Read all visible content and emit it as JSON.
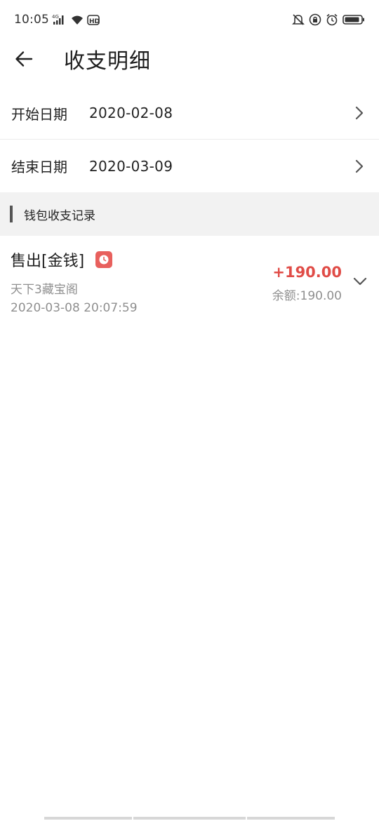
{
  "status_bar": {
    "time": "10:05",
    "network": "4G",
    "hd": "HD",
    "icons": [
      "signal-icon",
      "wifi-icon",
      "hd-icon",
      "mute-icon",
      "lock-rotation-icon",
      "alarm-icon",
      "battery-icon"
    ]
  },
  "header": {
    "title": "收支明细",
    "back_icon": "back-arrow-icon"
  },
  "dates": [
    {
      "label": "开始日期",
      "value": "2020-02-08"
    },
    {
      "label": "结束日期",
      "value": "2020-03-09"
    }
  ],
  "section": {
    "title": "钱包收支记录"
  },
  "records": [
    {
      "title": "售出[金钱]",
      "badge_icon": "clock-icon",
      "source": "天下3藏宝阁",
      "time": "2020-03-08 20:07:59",
      "amount": "+190.00",
      "balance_label": "余额:",
      "balance_value": "190.00"
    }
  ],
  "colors": {
    "amount_positive": "#e04c47",
    "badge": "#e8605d",
    "muted_text": "#8f8f8f",
    "section_bg": "#f2f2f2"
  }
}
